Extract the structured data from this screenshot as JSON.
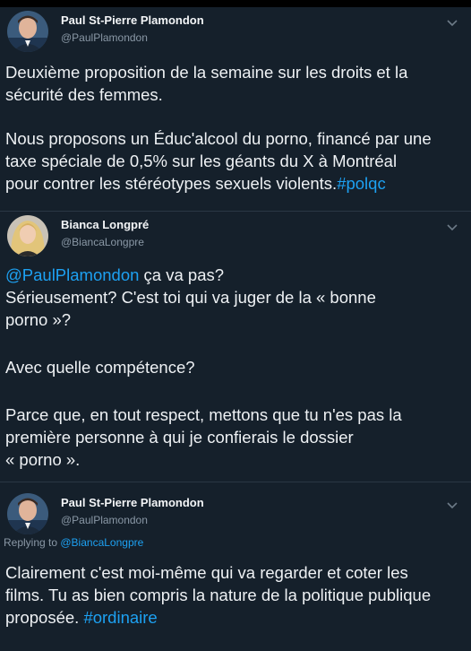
{
  "tweets": [
    {
      "author": {
        "name": "Paul St-Pierre Plamondon",
        "handle": "@PaulPlamondon"
      },
      "body": {
        "line1": "Deuxième proposition de la semaine sur les droits et la",
        "line2": "sécurité des femmes.",
        "line3": "Nous proposons un Éduc'alcool du porno, financé par une",
        "line4": "taxe spéciale de 0,5% sur les géants du X à Montréal",
        "line5": "pour contrer les stéréotypes sexuels violents.",
        "hashtag": "#polqc"
      }
    },
    {
      "author": {
        "name": "Bianca Longpré",
        "handle": "@BiancaLongpre"
      },
      "body": {
        "mention": "@PaulPlamondon",
        "line1_rest": " ça va pas?",
        "line2": "Sérieusement? C'est toi qui va juger  de la « bonne",
        "line3": "porno »?",
        "line4": "Avec quelle compétence?",
        "line5": "Parce que, en tout respect, mettons que tu n'es pas la",
        "line6": "première personne à qui je confierais le dossier",
        "line7": "« porno »."
      }
    },
    {
      "author": {
        "name": "Paul St-Pierre Plamondon",
        "handle": "@PaulPlamondon"
      },
      "replying_to": {
        "prefix": "Replying to ",
        "handle": "@BiancaLongpre"
      },
      "body": {
        "line1": "Clairement c'est moi-même qui va regarder et coter les",
        "line2": "films. Tu as bien compris la nature de la politique publique",
        "line3": "proposée. ",
        "hashtag": "#ordinaire"
      }
    }
  ],
  "icons": {
    "chevron": "chevron-down-icon",
    "avatar": "avatar"
  },
  "colors": {
    "background": "#15202b",
    "link": "#1da1f2",
    "text": "#eef1f4",
    "muted": "#8a98a6"
  }
}
